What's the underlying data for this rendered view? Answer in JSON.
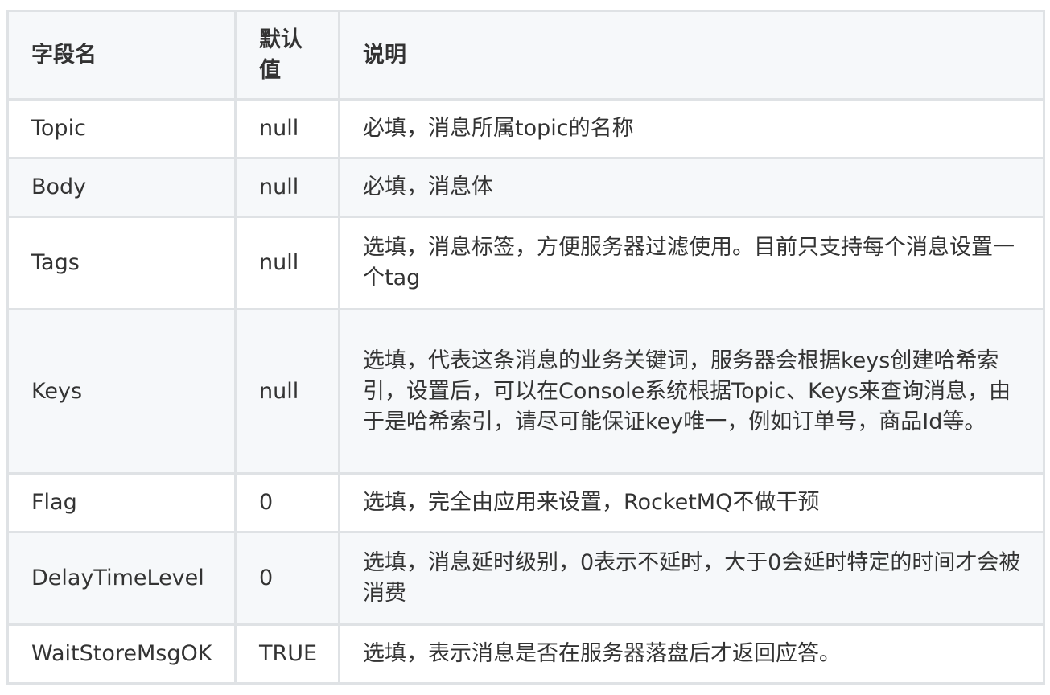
{
  "table": {
    "headers": [
      "字段名",
      "默认值",
      "说明"
    ],
    "rows": [
      {
        "field": "Topic",
        "default": "null",
        "desc": "必填，消息所属topic的名称"
      },
      {
        "field": "Body",
        "default": "null",
        "desc": "必填，消息体"
      },
      {
        "field": "Tags",
        "default": "null",
        "desc": "选填，消息标签，方便服务器过滤使用。目前只支持每个消息设置一个tag"
      },
      {
        "field": "Keys",
        "default": "null",
        "desc": "选填，代表这条消息的业务关键词，服务器会根据keys创建哈希索引，设置后，可以在Console系统根据Topic、Keys来查询消息，由于是哈希索引，请尽可能保证key唯一，例如订单号，商品Id等。"
      },
      {
        "field": "Flag",
        "default": "0",
        "desc": "选填，完全由应用来设置，RocketMQ不做干预"
      },
      {
        "field": "DelayTimeLevel",
        "default": "0",
        "desc": "选填，消息延时级别，0表示不延时，大于0会延时特定的时间才会被消费"
      },
      {
        "field": "WaitStoreMsgOK",
        "default": "TRUE",
        "desc": "选填，表示消息是否在服务器落盘后才返回应答。"
      }
    ]
  },
  "colors": {
    "border": "#dfe2e5",
    "header_bg": "#f6f8fa",
    "stripe_bg": "#f6f8fa",
    "text": "#333333"
  }
}
